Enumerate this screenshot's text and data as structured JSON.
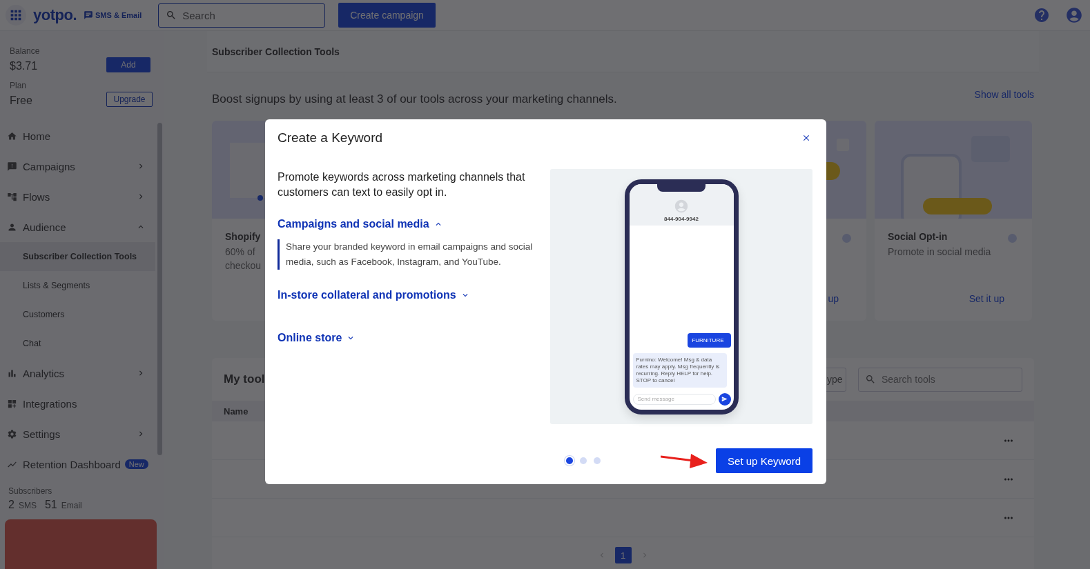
{
  "topbar": {
    "brand": "yotpo.",
    "product": "SMS & Email",
    "search": {
      "placeholder": "Search"
    },
    "create_button": "Create campaign"
  },
  "sidebar": {
    "balance_label": "Balance",
    "balance": "$3.71",
    "add_button": "Add",
    "plan_label": "Plan",
    "plan": "Free",
    "upgrade_button": "Upgrade",
    "nav": [
      {
        "label": "Home",
        "kind": "link"
      },
      {
        "label": "Campaigns",
        "kind": "group",
        "expanded": false
      },
      {
        "label": "Flows",
        "kind": "group",
        "expanded": false
      },
      {
        "label": "Audience",
        "kind": "group",
        "expanded": true,
        "children": [
          {
            "label": "Subscriber Collection Tools",
            "selected": true
          },
          {
            "label": "Lists & Segments",
            "selected": false
          },
          {
            "label": "Customers",
            "selected": false
          },
          {
            "label": "Chat",
            "selected": false
          }
        ]
      },
      {
        "label": "Analytics",
        "kind": "group",
        "expanded": false
      },
      {
        "label": "Integrations",
        "kind": "link"
      },
      {
        "label": "Settings",
        "kind": "group",
        "expanded": false
      },
      {
        "label": "Retention Dashboard",
        "kind": "link",
        "badge": "New"
      }
    ],
    "subscribers": {
      "label": "Subscribers",
      "sms_count": "2",
      "sms_label": "SMS",
      "email_count": "51",
      "email_label": "Email"
    }
  },
  "main": {
    "title": "Subscriber Collection Tools",
    "intro": "Boost signups by using at least 3 of our tools across your marketing channels.",
    "show_all": "Show all tools",
    "cards": [
      {
        "title": "Shopify",
        "description": [
          "60% of",
          "checkou"
        ]
      },
      {
        "action": "up"
      },
      {
        "title": "Social Opt-in",
        "description": [
          "Promote in social media"
        ],
        "action": "Set it up"
      }
    ],
    "my_tools": {
      "title": "My tool",
      "filter": "ype",
      "search": {
        "placeholder": "Search tools"
      },
      "columns": [
        "Name"
      ],
      "pages": [
        {
          "label": "1",
          "selected": true
        }
      ]
    }
  },
  "modal": {
    "title": "Create a Keyword",
    "intro": "Promote keywords across marketing channels that customers can text to easily opt in.",
    "sections": [
      {
        "title": "Campaigns and social media",
        "expanded": true,
        "body": "Share your branded keyword in email campaigns and social media, such as Facebook, Instagram, and YouTube."
      },
      {
        "title": "In-store collateral and promotions",
        "expanded": false
      },
      {
        "title": "Online store",
        "expanded": false
      }
    ],
    "phone": {
      "number": "844-904-9942",
      "sent": "FURNITURE",
      "reply": "Furnino: Welcome! Msg & data rates may apply. Msg frequently is recurring. Reply HELP for help. STOP to cancel",
      "input_placeholder": "Send message"
    },
    "steps": [
      {
        "selected": true
      },
      {
        "selected": false
      },
      {
        "selected": false
      }
    ],
    "primary_button": "Set up Keyword"
  }
}
